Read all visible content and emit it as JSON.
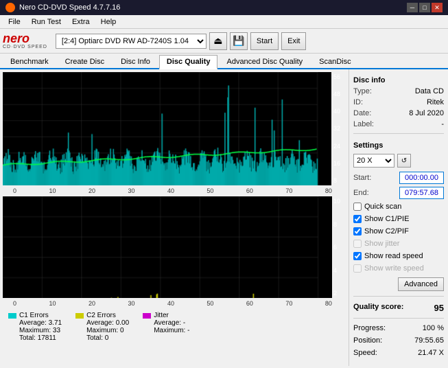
{
  "titlebar": {
    "title": "Nero CD-DVD Speed 4.7.7.16",
    "controls": [
      "minimize",
      "maximize",
      "close"
    ]
  },
  "menubar": {
    "items": [
      "File",
      "Run Test",
      "Extra",
      "Help"
    ]
  },
  "toolbar": {
    "logo": "nero",
    "logo_sub": "CD·DVD SPEED",
    "drive_label": "[2:4]  Optiarc DVD RW AD-7240S 1.04",
    "start_label": "Start",
    "exit_label": "Exit"
  },
  "tabs": [
    {
      "label": "Benchmark",
      "active": false
    },
    {
      "label": "Create Disc",
      "active": false
    },
    {
      "label": "Disc Info",
      "active": false
    },
    {
      "label": "Disc Quality",
      "active": true
    },
    {
      "label": "Advanced Disc Quality",
      "active": false
    },
    {
      "label": "ScanDisc",
      "active": false
    }
  ],
  "chart": {
    "top": {
      "y_labels": [
        "56",
        "48",
        "40",
        "32",
        "24",
        "16",
        "8"
      ],
      "x_labels": [
        "0",
        "10",
        "20",
        "30",
        "40",
        "50",
        "60",
        "70",
        "80"
      ]
    },
    "bottom": {
      "y_labels": [
        "10",
        "8",
        "6",
        "4",
        "2"
      ],
      "x_labels": [
        "0",
        "10",
        "20",
        "30",
        "40",
        "50",
        "60",
        "70",
        "80"
      ]
    }
  },
  "legend": {
    "c1": {
      "label": "C1 Errors",
      "color": "#00cccc",
      "average_label": "Average:",
      "average_value": "3.71",
      "maximum_label": "Maximum:",
      "maximum_value": "33",
      "total_label": "Total:",
      "total_value": "17811"
    },
    "c2": {
      "label": "C2 Errors",
      "color": "#cccc00",
      "average_label": "Average:",
      "average_value": "0.00",
      "maximum_label": "Maximum:",
      "maximum_value": "0",
      "total_label": "Total:",
      "total_value": "0"
    },
    "jitter": {
      "label": "Jitter",
      "color": "#cc00cc",
      "average_label": "Average:",
      "average_value": "-",
      "maximum_label": "Maximum:",
      "maximum_value": "-",
      "total_label": "",
      "total_value": ""
    }
  },
  "disc_info": {
    "section_title": "Disc info",
    "type_label": "Type:",
    "type_value": "Data CD",
    "id_label": "ID:",
    "id_value": "Ritek",
    "date_label": "Date:",
    "date_value": "8 Jul 2020",
    "label_label": "Label:",
    "label_value": "-"
  },
  "settings": {
    "section_title": "Settings",
    "speed_value": "20 X",
    "start_label": "Start:",
    "start_value": "000:00.00",
    "end_label": "End:",
    "end_value": "079:57.68",
    "quick_scan_label": "Quick scan",
    "quick_scan_checked": false,
    "show_c1_pie_label": "Show C1/PIE",
    "show_c1_pie_checked": true,
    "show_c2_pif_label": "Show C2/PIF",
    "show_c2_pif_checked": true,
    "show_jitter_label": "Show jitter",
    "show_jitter_checked": false,
    "show_jitter_enabled": false,
    "show_read_speed_label": "Show read speed",
    "show_read_speed_checked": true,
    "show_write_speed_label": "Show write speed",
    "show_write_speed_checked": false,
    "show_write_speed_enabled": false,
    "advanced_label": "Advanced"
  },
  "results": {
    "quality_score_label": "Quality score:",
    "quality_score_value": "95",
    "progress_label": "Progress:",
    "progress_value": "100 %",
    "position_label": "Position:",
    "position_value": "79:55.65",
    "speed_label": "Speed:",
    "speed_value": "21.47 X"
  }
}
